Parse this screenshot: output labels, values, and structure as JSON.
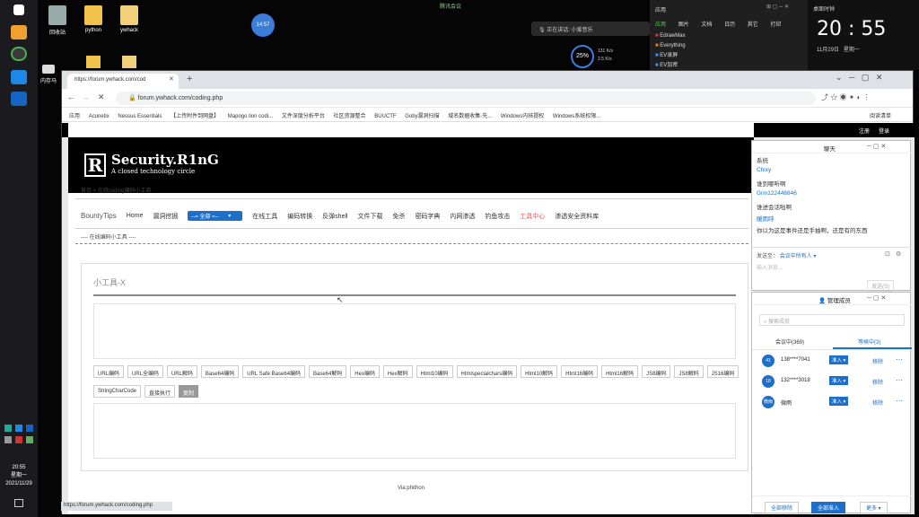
{
  "desktop": {
    "icons": [
      {
        "label": "回收站"
      },
      {
        "label": "python"
      },
      {
        "label": "ywhack"
      },
      {
        "label": "内存马"
      }
    ],
    "timer": "14:57",
    "meeting_status": "腾讯会议",
    "speaking": "正在讲话: 小爱音乐",
    "net_percent": "25%",
    "net_up": "131 K/s",
    "net_down": "2.5 K/s",
    "taskbar_time": "20:55",
    "taskbar_day": "星期一",
    "taskbar_date": "2021/11/29"
  },
  "right_panel": {
    "header": "应用",
    "tabs": [
      "应用",
      "图片",
      "文档",
      "日历",
      "其它",
      "打印"
    ],
    "apps": [
      "EdrawMax",
      "Everything",
      "EV录屏",
      "EV加密"
    ]
  },
  "clock": {
    "label": "桌面时钟",
    "time": "20 : 55",
    "date": "11月29日",
    "weekday": "星期一"
  },
  "browser": {
    "tab_title": "https://forum.ywhack.com/cod",
    "url": "forum.ywhack.com/coding.php",
    "bookmarks": [
      "应用",
      "Acunetix",
      "Nessus Essentials",
      "【上传附件到网盘】",
      "Mapogo lion codi...",
      "文件深度分析平台",
      "社区资源整合",
      "BUUCTF",
      "Goby漏洞扫描",
      "域名数据收集-先...",
      "Windows内核提权",
      "Windows系统权限..."
    ],
    "reading_list": "阅读清单",
    "status_url": "https://forum.ywhack.com/coding.php"
  },
  "site": {
    "logo_mark": "R",
    "title": "Security.R1nG",
    "subtitle": "A closed technology circle",
    "login": "注册",
    "register": "登录",
    "breadcrumb": "首页 > 在线coding编码小工具",
    "nav": {
      "brand": "BountyTips",
      "items": [
        "Home",
        "漏洞挖掘",
        "在线工具",
        "编码转换",
        "反弹shell",
        "文件下载",
        "免杀",
        "密码字典",
        "内网渗透",
        "钓鱼攻击"
      ],
      "select": "--= 全部 =--",
      "hot": "工具中心",
      "last": "渗透安全资料库"
    },
    "section": "----  在线编码小工具  ----",
    "panel_title": "小工具-X",
    "buttons_row1": [
      "URL编码",
      "URL全编码",
      "URL解码",
      "Base64编码",
      "URL Safe Base64编码",
      "Base64解码",
      "Hex编码",
      "Hex解码",
      "Html10编码",
      "Htmlspecialchars编码",
      "Html10解码",
      "Html16编码",
      "Html16解码",
      "JS8编码",
      "JS8解码",
      "JS16编码"
    ],
    "buttons_row2": [
      "StringCharCode",
      "直接执行",
      "复制"
    ],
    "footer": "Via:phithon"
  },
  "chat": {
    "title": "聊天",
    "lines": [
      "系统",
      "Chixy",
      "谁到哪听啊",
      "Grin122446846",
      "谁进会话啦啊",
      "暖雨呼",
      "你以为这是事件还是手抽啊，还是有的东西"
    ],
    "send_to_label": "发送至：",
    "send_to_value": "会议中所有人",
    "input_placeholder": "输入消息...",
    "send": "发送(S)"
  },
  "members": {
    "title": "管理成员",
    "search_placeholder": "搜索成员",
    "tab_in": "会议中(369)",
    "tab_wait": "等候中(3)",
    "rows": [
      {
        "avatar": "41",
        "name": "138****7041",
        "action": "准入",
        "remove": "移除"
      },
      {
        "avatar": "18",
        "name": "132****3018",
        "action": "准入",
        "remove": "移除"
      },
      {
        "avatar": "微雨",
        "name": "微雨",
        "action": "准入",
        "remove": "移除"
      }
    ],
    "remove_all": "全部移除",
    "admit_all": "全部准入",
    "more": "更多"
  }
}
